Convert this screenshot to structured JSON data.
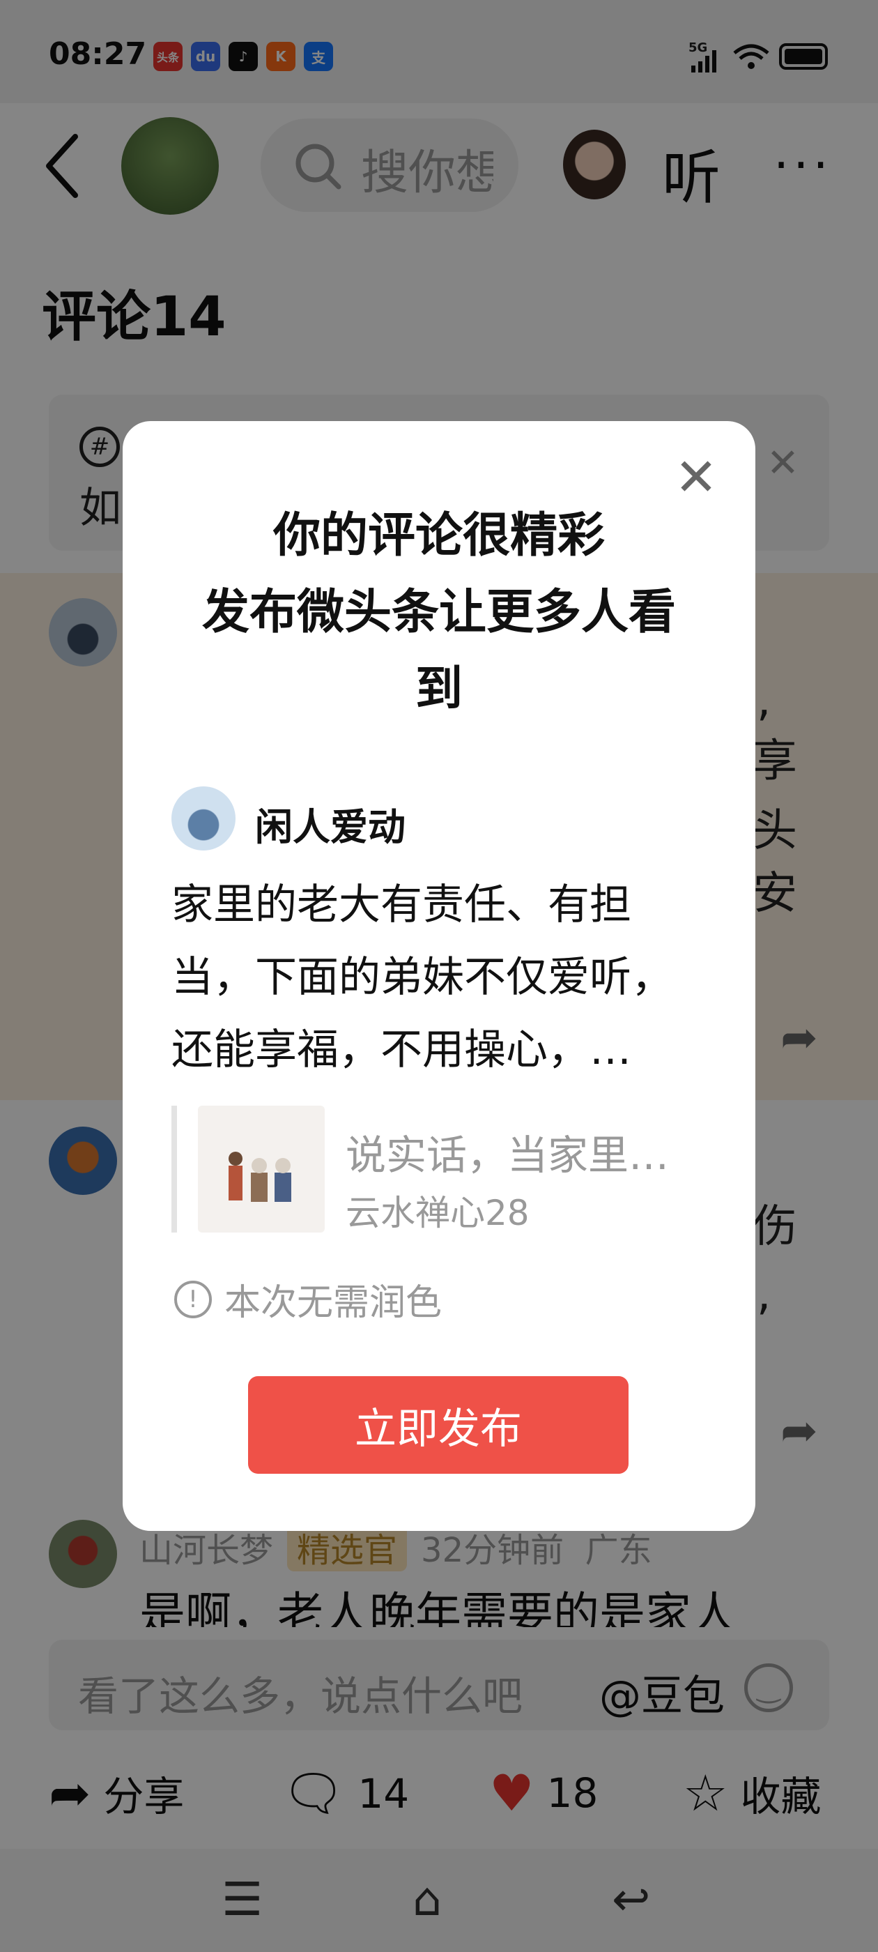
{
  "status_bar": {
    "time": "08:27",
    "app_icons": [
      {
        "name": "toutiao-icon",
        "label": "头条",
        "color": "#e8342e"
      },
      {
        "name": "baidu-icon",
        "label": "du",
        "color": "#3a6ef0"
      },
      {
        "name": "tiktok-icon",
        "label": "♪",
        "color": "#111111"
      },
      {
        "name": "kuaishou-icon",
        "label": "K",
        "color": "#ff6a1a"
      },
      {
        "name": "alipay-icon",
        "label": "支",
        "color": "#1677ff"
      }
    ],
    "signal": "5G"
  },
  "header": {
    "search_placeholder": "搜你想",
    "listen_label": "听",
    "more_label": "···"
  },
  "comments_title": "评论14",
  "topic": {
    "icon_text": "#",
    "text_fragment": "如"
  },
  "comment_fragments": {
    "row1_right": [
      ",",
      "享",
      "头",
      "安"
    ],
    "row2_right": [
      "伤",
      ","
    ]
  },
  "comment3": {
    "author": "山河长梦",
    "badge": "精选官",
    "time": "32分钟前",
    "location": "广东",
    "text": "是啊，老人晚年需要的是家人"
  },
  "input_bar": {
    "placeholder": "看了这么多，说点什么吧",
    "mention": "@豆包"
  },
  "bottom_actions": {
    "share": "分享",
    "comments_count": "14",
    "likes_count": "18",
    "collect": "收藏"
  },
  "modal": {
    "title_lines": [
      "你的评论很精彩",
      "发布微头条让更多人看",
      "到"
    ],
    "author_name": "闲人爱动",
    "body_lines": [
      "家里的老大有责任、有担",
      "当，下面的弟妹不仅爱听，",
      "还能享福，不用操心，…"
    ],
    "quote_title": "说实话，当家里…",
    "quote_author": "云水禅心28",
    "notice": "本次无需润色",
    "publish_label": "立即发布"
  },
  "colors": {
    "accent_red": "#ef5148",
    "heart_red": "#e8342e"
  }
}
